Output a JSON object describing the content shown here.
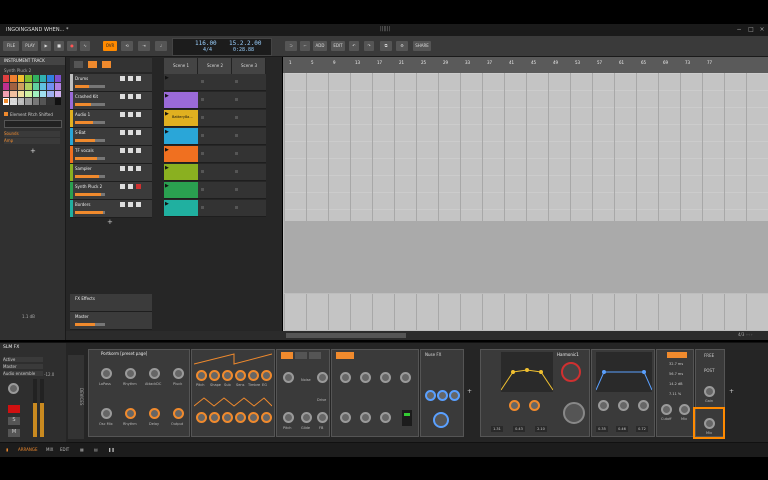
{
  "window": {
    "title": "INGOINGSAND WHEN... *",
    "logo": "||||||"
  },
  "toolbar": {
    "file": "FILE",
    "play_menu": "PLAY",
    "ovr": "OVR",
    "tempo": "116.00",
    "signature": "4/4",
    "position": "15.2.2.00",
    "time": "0:28.88",
    "add": "ADD",
    "edit": "EDIT",
    "share": "SHARE"
  },
  "inspector": {
    "header": "INSTRUMENT TRACK",
    "track_name": "Synth Pluck 2",
    "active": "Active",
    "element": "Element Pitch Shifted",
    "sends_label": "Sounds",
    "sends_value": "Amp",
    "level_label": "1.1 dB"
  },
  "scenes": [
    "Scene 1",
    "Scene 2",
    "Scene 3"
  ],
  "scene_row_labels": [
    "Scene 1",
    "Scene 2",
    "Scene 3"
  ],
  "tracks": [
    {
      "name": "Drums",
      "color": "#c0c0c0",
      "clip": ""
    },
    {
      "name": "Crashed Kit",
      "color": "#9a6ad8",
      "clip": ""
    },
    {
      "name": "Audio 1",
      "color": "#e0b020",
      "clip": "Battery8a..."
    },
    {
      "name": "S-Bat",
      "color": "#2aa6d8",
      "clip": ""
    },
    {
      "name": "TF vocals",
      "color": "#f07020",
      "clip": ""
    },
    {
      "name": "Sampler",
      "color": "#8ab020",
      "clip": ""
    },
    {
      "name": "Synth Pluck 2",
      "color": "#2aa050",
      "clip": ""
    },
    {
      "name": "Borders",
      "color": "#20b0a0",
      "clip": ""
    }
  ],
  "effects_track": "FX Effects",
  "master_track": "Master",
  "ruler": [
    "1",
    "5",
    "9",
    "13",
    "17",
    "21",
    "25",
    "29",
    "33",
    "37",
    "41",
    "45",
    "49",
    "53",
    "57",
    "61",
    "65",
    "69",
    "73",
    "77"
  ],
  "zoom": "4/3 ◦◦◦",
  "devices": {
    "chain_label": "SLM FX",
    "mixer_items": [
      "Active",
      "Master",
      "Audio ensemble"
    ],
    "level": "-12.0",
    "device_stack": "DEVICES",
    "device1_name": "Portkorm [preset page]",
    "polysynth_knobs": [
      "LoPass",
      "Rhythm",
      "AttackDC",
      "Pluck",
      "Osc Mix",
      "Rhythm",
      "Delay",
      "Output"
    ],
    "osc_knobs": [
      "Pitch",
      "Shape",
      "Sub",
      "Sens",
      "Timbre",
      "EG"
    ],
    "filter_knobs": [
      "Noise",
      "Drive",
      "Pitch",
      "Glide",
      "FB"
    ],
    "filter_label": "Nuse FX",
    "eq_label": "Harmonic1",
    "eq_values": [
      "1.31",
      "0.43",
      "2.10",
      "0.35",
      "0.46",
      "0.72"
    ],
    "comp_values": [
      "32.7 ms",
      "56.7 ms",
      "14.2 dB",
      "7.11 %"
    ],
    "comp_labels": [
      "Cutoff",
      "Mix"
    ],
    "last_device": [
      "FREE",
      "POST",
      "Gain",
      "Mix"
    ]
  },
  "status": {
    "arrange": "ARRANGE",
    "mix": "MIX",
    "edit": "EDIT"
  }
}
